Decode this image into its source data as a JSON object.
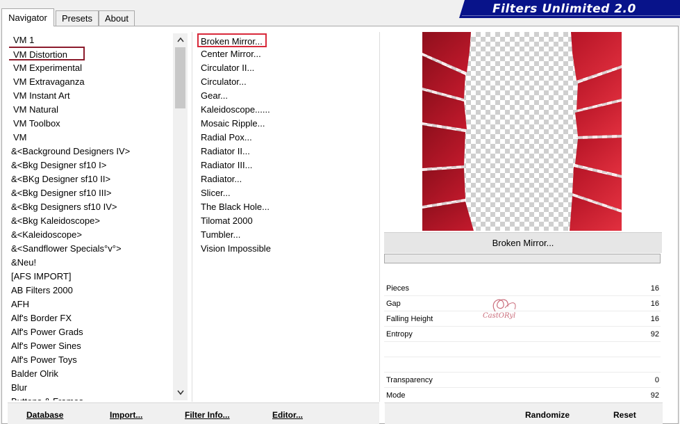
{
  "tabs": [
    {
      "label": "Navigator"
    },
    {
      "label": "Presets"
    },
    {
      "label": "About"
    }
  ],
  "banner": {
    "title": "Filters Unlimited 2.0",
    "color": "#08138a"
  },
  "categories": [
    {
      "label": "VM 1"
    },
    {
      "label": "VM Distortion",
      "selected": true
    },
    {
      "label": "VM Experimental"
    },
    {
      "label": "VM Extravaganza"
    },
    {
      "label": "VM Instant Art"
    },
    {
      "label": "VM Natural"
    },
    {
      "label": "VM Toolbox"
    },
    {
      "label": "VM"
    },
    {
      "label": "&<Background Designers IV>"
    },
    {
      "label": "&<Bkg Designer sf10 I>"
    },
    {
      "label": "&<BKg Designer sf10 II>"
    },
    {
      "label": "&<Bkg Designer sf10 III>"
    },
    {
      "label": "&<Bkg Designers sf10 IV>"
    },
    {
      "label": "&<Bkg Kaleidoscope>"
    },
    {
      "label": "&<Kaleidoscope>"
    },
    {
      "label": "&<Sandflower Specials°v°>"
    },
    {
      "label": "&Neu!"
    },
    {
      "label": "[AFS IMPORT]"
    },
    {
      "label": "AB Filters 2000"
    },
    {
      "label": "AFH"
    },
    {
      "label": "Alf's Border FX"
    },
    {
      "label": "Alf's Power Grads"
    },
    {
      "label": "Alf's Power Sines"
    },
    {
      "label": "Alf's Power Toys"
    },
    {
      "label": "Balder Olrik"
    },
    {
      "label": "Blur"
    },
    {
      "label": "Buttons & Frames"
    }
  ],
  "filters": [
    {
      "label": "Broken Mirror...",
      "selected": true
    },
    {
      "label": "Center Mirror..."
    },
    {
      "label": "Circulator II..."
    },
    {
      "label": "Circulator..."
    },
    {
      "label": "Gear..."
    },
    {
      "label": "Kaleidoscope......"
    },
    {
      "label": "Mosaic Ripple..."
    },
    {
      "label": "Radial Pox..."
    },
    {
      "label": "Radiator II..."
    },
    {
      "label": "Radiator III..."
    },
    {
      "label": "Radiator..."
    },
    {
      "label": "Slicer..."
    },
    {
      "label": "The Black Hole..."
    },
    {
      "label": "Tilomat 2000"
    },
    {
      "label": "Tumbler..."
    },
    {
      "label": "Vision Impossible"
    }
  ],
  "preview": {
    "filter_name": "Broken Mirror...",
    "accent": "#c0182c"
  },
  "params": [
    {
      "label": "Pieces",
      "value": "16"
    },
    {
      "label": "Gap",
      "value": "16"
    },
    {
      "label": "Falling Height",
      "value": "16"
    },
    {
      "label": "Entropy",
      "value": "92"
    },
    {
      "label": "",
      "value": ""
    },
    {
      "label": "",
      "value": ""
    },
    {
      "label": "Transparency",
      "value": "0"
    },
    {
      "label": "Mode",
      "value": "92"
    }
  ],
  "watermark": {
    "text": "CastORyl"
  },
  "buttons": {
    "database": "Database",
    "import": "Import...",
    "filter_info": "Filter Info...",
    "editor": "Editor...",
    "randomize": "Randomize",
    "reset": "Reset"
  },
  "icons": {
    "scroll_up": "scroll-up-icon",
    "scroll_down": "scroll-down-icon"
  }
}
